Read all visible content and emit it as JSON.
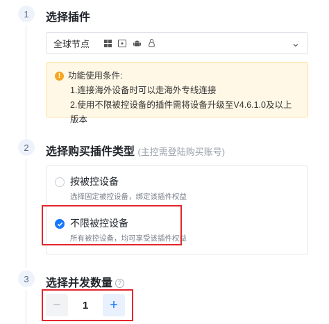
{
  "steps": [
    {
      "number": "1",
      "title": "选择插件"
    },
    {
      "number": "2",
      "title": "选择购买插件类型",
      "subtitle": "(主控需登陆购买账号)"
    },
    {
      "number": "3",
      "title": "选择并发数量"
    }
  ],
  "plugin_select": {
    "value": "全球节点",
    "os_icons": [
      "windows-icon",
      "macos-icon",
      "android-icon",
      "linux-icon"
    ]
  },
  "notice": {
    "title": "功能使用条件:",
    "lines": [
      "1.连接海外设备时可以走海外专线连接",
      "2.使用不限被控设备的插件需将设备升级至V4.6.1.0及以上版本"
    ]
  },
  "plans": [
    {
      "title": "按被控设备",
      "desc": "选择固定被控设备，绑定该插件权益",
      "selected": false
    },
    {
      "title": "不限被控设备",
      "desc": "所有被控设备，均可享受该插件权益",
      "selected": true
    }
  ],
  "quantity": {
    "minus_label": "−",
    "value": "1",
    "plus_label": "+"
  },
  "colors": {
    "accent": "#1677ff",
    "highlight": "#e2262c",
    "warning": "#f5a623"
  }
}
